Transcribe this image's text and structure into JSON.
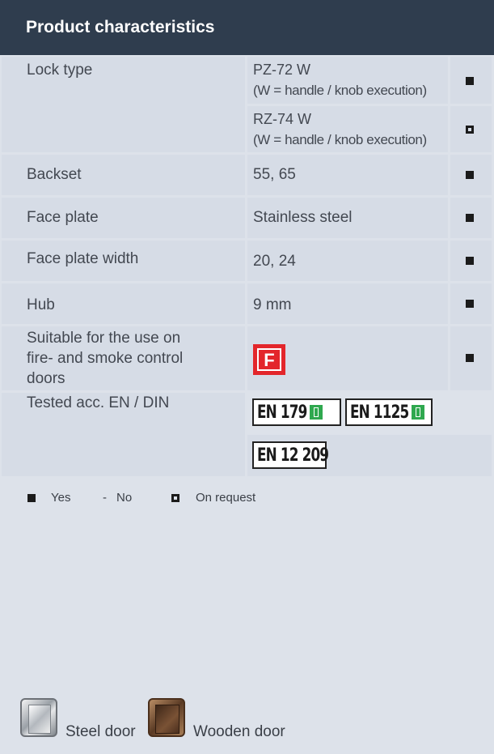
{
  "header": {
    "title": "Product characteristics"
  },
  "rows": {
    "lock_type": {
      "label": "Lock type",
      "opt1_line1": "PZ-72 W",
      "opt1_line2": "(W = handle / knob execution)",
      "opt1_mark": "yes",
      "opt2_line1": "RZ-74 W",
      "opt2_line2": "(W = handle / knob execution)",
      "opt2_mark": "on request"
    },
    "backset": {
      "label": "Backset",
      "value": "55, 65",
      "mark": "yes"
    },
    "face_plate": {
      "label": "Face plate",
      "value": "Stainless steel",
      "mark": "yes"
    },
    "face_plate_width": {
      "label": "Face plate width",
      "value": "20, 24",
      "mark": "yes"
    },
    "hub": {
      "label": "Hub",
      "value": "9 mm",
      "mark": "yes"
    },
    "fire": {
      "label_line1": "Suitable for the use on",
      "label_line2": "fire- and smoke control",
      "label_line3": "doors",
      "badge": "F",
      "mark": "yes"
    },
    "tested": {
      "label": "Tested acc. EN / DIN",
      "badges": [
        "EN 179",
        "EN 1125",
        "EN 12 209"
      ]
    }
  },
  "legend": {
    "yes": "Yes",
    "no_symbol": "-",
    "no": "No",
    "on_request": "On request"
  },
  "doors": {
    "steel": "Steel door",
    "wooden": "Wooden door"
  },
  "colors": {
    "header_bg": "#2f3d4e",
    "cell_bg": "#d6dce6",
    "page_bg": "#dde2ea",
    "fire_red": "#e3262b",
    "exit_green": "#2fa84f"
  }
}
